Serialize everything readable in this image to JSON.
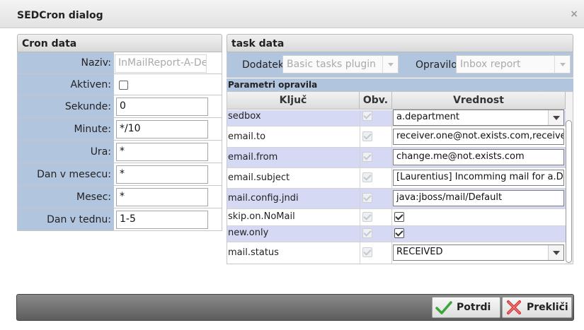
{
  "dialog": {
    "title": "SEDCron dialog",
    "close_glyph": "×"
  },
  "cron": {
    "header": "Cron data",
    "fields": [
      {
        "label": "Naziv:",
        "value": "InMailReport-A-Dep",
        "readonly": true
      },
      {
        "label": "Aktiven:",
        "checked": false
      },
      {
        "label": "Sekunde:",
        "value": "0"
      },
      {
        "label": "Minute:",
        "value": "*/10"
      },
      {
        "label": "Ura:",
        "value": "*"
      },
      {
        "label": "Dan v mesecu:",
        "value": "*"
      },
      {
        "label": "Mesec:",
        "value": "*"
      },
      {
        "label": "Dan v tednu:",
        "value": "1-5"
      }
    ]
  },
  "task": {
    "header": "task data",
    "dodatek_label": "Dodatek",
    "dodatek_value": "Basic tasks plugin",
    "opravilo_label": "Opravilo",
    "opravilo_value": "Inbox report",
    "params_header": "Parametri opravila",
    "columns": [
      "Ključ",
      "Obv.",
      "Vrednost"
    ],
    "rows": [
      {
        "key": "sedbox",
        "value": "a.department",
        "type": "select"
      },
      {
        "key": "email.to",
        "value": "receiver.one@not.exists.com,receiver.tw",
        "type": "text"
      },
      {
        "key": "email.from",
        "value": "change.me@not.exists.com",
        "type": "text"
      },
      {
        "key": "email.subject",
        "value": "[Laurentius] Incomming mail for a.Depar",
        "type": "text"
      },
      {
        "key": "mail.config.jndi",
        "value": "java:jboss/mail/Default",
        "type": "text"
      },
      {
        "key": "skip.on.NoMail",
        "value": "",
        "type": "check",
        "checked": true
      },
      {
        "key": "new.only",
        "value": "",
        "type": "check",
        "checked": true
      },
      {
        "key": "mail.status",
        "value": "RECEIVED",
        "type": "select"
      }
    ]
  },
  "footer": {
    "confirm_label": "Potrdi",
    "cancel_label": "Prekliči"
  },
  "colors": {
    "label_bg": "#b2c5de",
    "alt_row": "#d5d9f4",
    "footer_bg": "#6e6e6e",
    "confirm_icon": "#3aa63a",
    "cancel_icon": "#d03030"
  }
}
